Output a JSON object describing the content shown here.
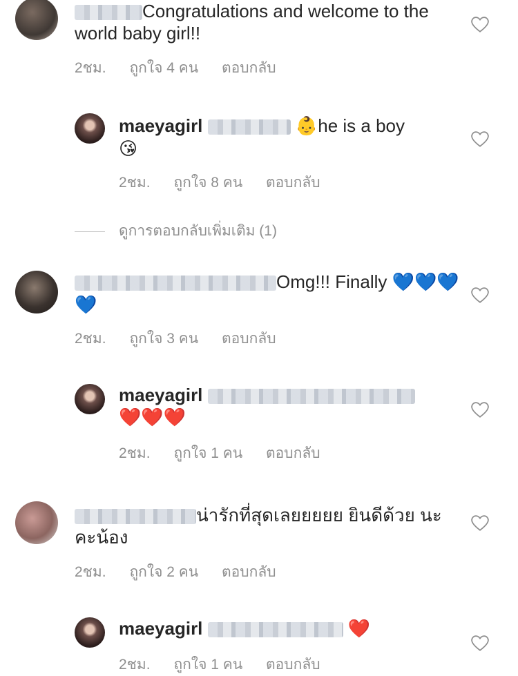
{
  "comments": [
    {
      "text": "Congratulations and welcome to the world baby girl!!",
      "time": "2ชม.",
      "likes": "ถูกใจ 4 คน",
      "reply": "ตอบกลับ"
    },
    {
      "username": "maeyagirl",
      "text": "he is a boy",
      "emoji_before": "👶",
      "emoji_after": "😘",
      "time": "2ชม.",
      "likes": "ถูกใจ 8 คน",
      "reply": "ตอบกลับ"
    },
    {
      "text": "Omg!!! Finally",
      "emoji_hearts": "💙💙💙💙",
      "time": "2ชม.",
      "likes": "ถูกใจ 3 คน",
      "reply": "ตอบกลับ"
    },
    {
      "username": "maeyagirl",
      "emoji_hearts": "❤️❤️❤️",
      "time": "2ชม.",
      "likes": "ถูกใจ 1 คน",
      "reply": "ตอบกลับ"
    },
    {
      "text": "น่ารักที่สุดเลยยยยย ยินดีด้วย นะคะน้อง",
      "time": "2ชม.",
      "likes": "ถูกใจ 2 คน",
      "reply": "ตอบกลับ"
    },
    {
      "username": "maeyagirl",
      "emoji_hearts": "❤️",
      "time": "2ชม.",
      "likes": "ถูกใจ 1 คน",
      "reply": "ตอบกลับ"
    }
  ],
  "view_more_replies": "ดูการตอบกลับเพิ่มเติม (1)",
  "icons": {
    "like": "heart-outline-icon"
  },
  "colors": {
    "text": "#262626",
    "meta": "#8e8e8e"
  }
}
